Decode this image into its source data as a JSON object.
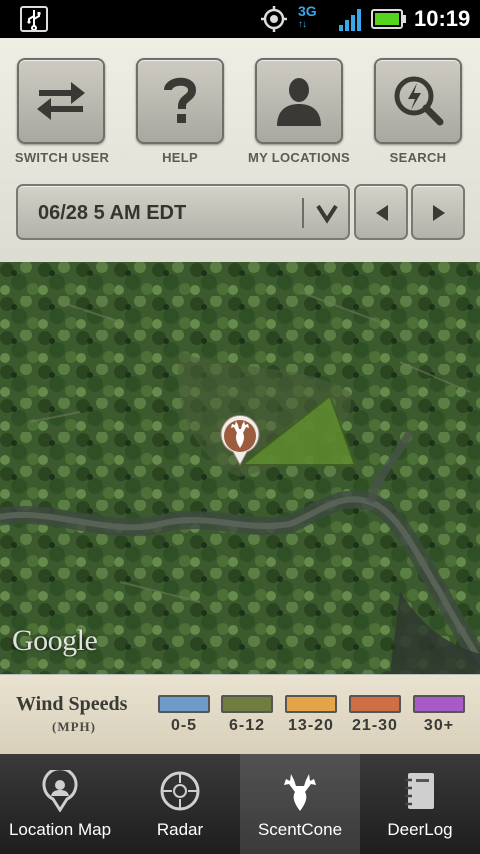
{
  "status_bar": {
    "network": "3G",
    "time": "10:19"
  },
  "toolbar": {
    "buttons": [
      {
        "label": "SWITCH USER",
        "icon": "switch-arrows-icon"
      },
      {
        "label": "HELP",
        "icon": "question-icon"
      },
      {
        "label": "MY LOCATIONS",
        "icon": "person-icon"
      },
      {
        "label": "SEARCH",
        "icon": "search-lightning-icon"
      }
    ],
    "date_selector": {
      "value": "06/28 5 AM EDT"
    }
  },
  "map": {
    "attribution": "Google"
  },
  "legend": {
    "title": "Wind Speeds",
    "unit": "(MPH)",
    "ranges": [
      {
        "label": "0-5",
        "color": "#6f9bc8"
      },
      {
        "label": "6-12",
        "color": "#6f7e3e"
      },
      {
        "label": "13-20",
        "color": "#e4a54a"
      },
      {
        "label": "21-30",
        "color": "#cf6e45"
      },
      {
        "label": "30+",
        "color": "#a85bc6"
      }
    ]
  },
  "tabs": [
    {
      "label": "Location Map",
      "icon": "map-pin-icon",
      "active": false
    },
    {
      "label": "Radar",
      "icon": "radar-icon",
      "active": false
    },
    {
      "label": "ScentCone",
      "icon": "deer-icon",
      "active": true
    },
    {
      "label": "DeerLog",
      "icon": "notebook-icon",
      "active": false
    }
  ]
}
